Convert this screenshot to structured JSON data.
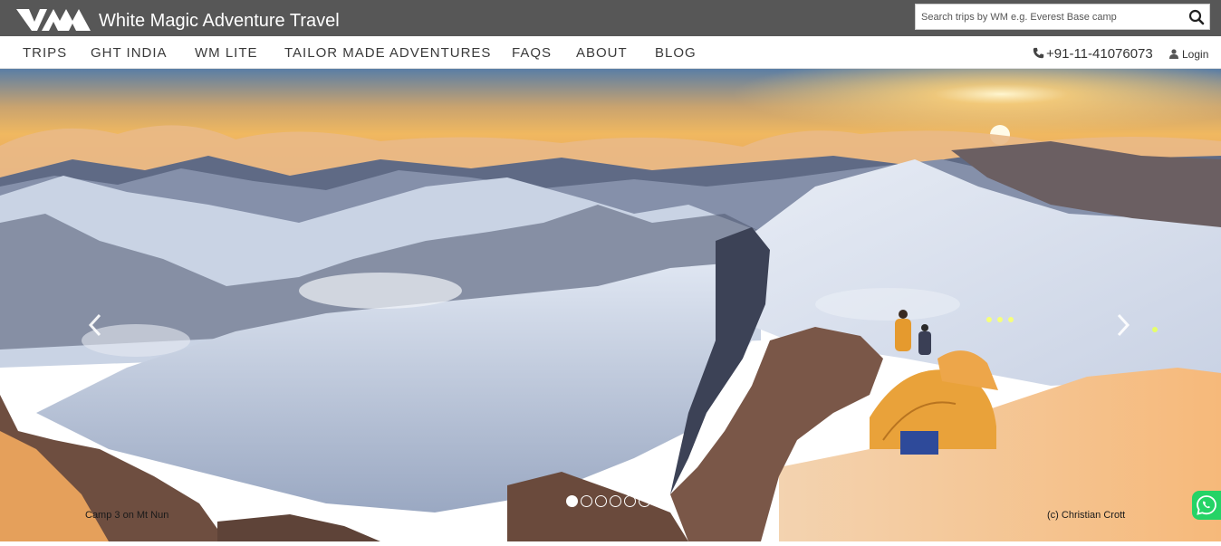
{
  "header": {
    "logo_text": "WM",
    "brand": "White Magic Adventure Travel",
    "search_placeholder": "Search trips by WM e.g. Everest Base camp"
  },
  "nav": {
    "items": [
      "TRIPS",
      "GHT INDIA",
      "WM LITE",
      "TAILOR MADE ADVENTURES",
      "FAQS",
      "ABOUT",
      "BLOG"
    ],
    "phone": "+91-11-41076073",
    "login": "Login"
  },
  "hero": {
    "caption_left": "Camp 3 on Mt Nun",
    "caption_right": "(c) Christian Crott",
    "slide_count": 6,
    "active_slide": 1
  },
  "colors": {
    "topbar": "#575757",
    "whatsapp": "#25d366"
  }
}
